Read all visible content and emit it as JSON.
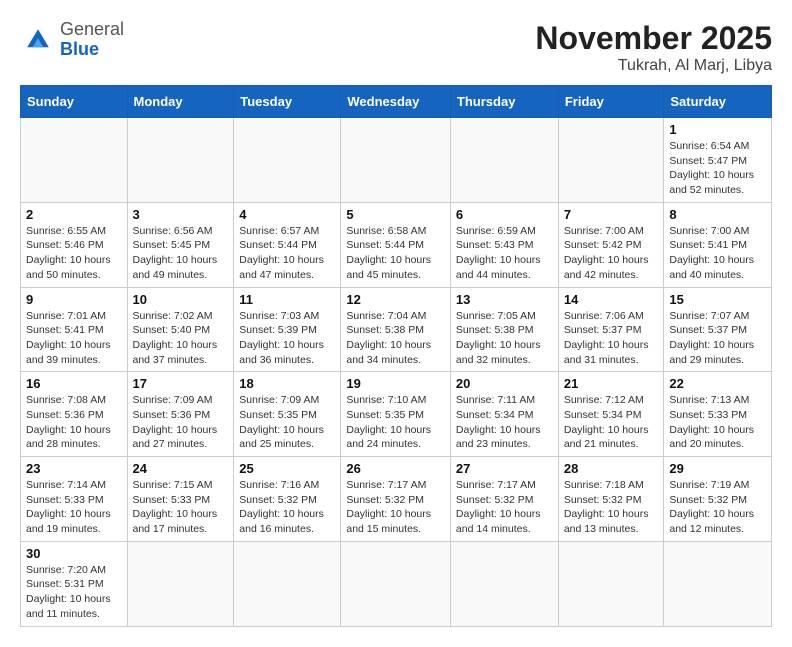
{
  "header": {
    "logo_general": "General",
    "logo_blue": "Blue",
    "month_title": "November 2025",
    "location": "Tukrah, Al Marj, Libya"
  },
  "weekdays": [
    "Sunday",
    "Monday",
    "Tuesday",
    "Wednesday",
    "Thursday",
    "Friday",
    "Saturday"
  ],
  "weeks": [
    [
      {
        "day": "",
        "info": ""
      },
      {
        "day": "",
        "info": ""
      },
      {
        "day": "",
        "info": ""
      },
      {
        "day": "",
        "info": ""
      },
      {
        "day": "",
        "info": ""
      },
      {
        "day": "",
        "info": ""
      },
      {
        "day": "1",
        "info": "Sunrise: 6:54 AM\nSunset: 5:47 PM\nDaylight: 10 hours and 52 minutes."
      }
    ],
    [
      {
        "day": "2",
        "info": "Sunrise: 6:55 AM\nSunset: 5:46 PM\nDaylight: 10 hours and 50 minutes."
      },
      {
        "day": "3",
        "info": "Sunrise: 6:56 AM\nSunset: 5:45 PM\nDaylight: 10 hours and 49 minutes."
      },
      {
        "day": "4",
        "info": "Sunrise: 6:57 AM\nSunset: 5:44 PM\nDaylight: 10 hours and 47 minutes."
      },
      {
        "day": "5",
        "info": "Sunrise: 6:58 AM\nSunset: 5:44 PM\nDaylight: 10 hours and 45 minutes."
      },
      {
        "day": "6",
        "info": "Sunrise: 6:59 AM\nSunset: 5:43 PM\nDaylight: 10 hours and 44 minutes."
      },
      {
        "day": "7",
        "info": "Sunrise: 7:00 AM\nSunset: 5:42 PM\nDaylight: 10 hours and 42 minutes."
      },
      {
        "day": "8",
        "info": "Sunrise: 7:00 AM\nSunset: 5:41 PM\nDaylight: 10 hours and 40 minutes."
      }
    ],
    [
      {
        "day": "9",
        "info": "Sunrise: 7:01 AM\nSunset: 5:41 PM\nDaylight: 10 hours and 39 minutes."
      },
      {
        "day": "10",
        "info": "Sunrise: 7:02 AM\nSunset: 5:40 PM\nDaylight: 10 hours and 37 minutes."
      },
      {
        "day": "11",
        "info": "Sunrise: 7:03 AM\nSunset: 5:39 PM\nDaylight: 10 hours and 36 minutes."
      },
      {
        "day": "12",
        "info": "Sunrise: 7:04 AM\nSunset: 5:38 PM\nDaylight: 10 hours and 34 minutes."
      },
      {
        "day": "13",
        "info": "Sunrise: 7:05 AM\nSunset: 5:38 PM\nDaylight: 10 hours and 32 minutes."
      },
      {
        "day": "14",
        "info": "Sunrise: 7:06 AM\nSunset: 5:37 PM\nDaylight: 10 hours and 31 minutes."
      },
      {
        "day": "15",
        "info": "Sunrise: 7:07 AM\nSunset: 5:37 PM\nDaylight: 10 hours and 29 minutes."
      }
    ],
    [
      {
        "day": "16",
        "info": "Sunrise: 7:08 AM\nSunset: 5:36 PM\nDaylight: 10 hours and 28 minutes."
      },
      {
        "day": "17",
        "info": "Sunrise: 7:09 AM\nSunset: 5:36 PM\nDaylight: 10 hours and 27 minutes."
      },
      {
        "day": "18",
        "info": "Sunrise: 7:09 AM\nSunset: 5:35 PM\nDaylight: 10 hours and 25 minutes."
      },
      {
        "day": "19",
        "info": "Sunrise: 7:10 AM\nSunset: 5:35 PM\nDaylight: 10 hours and 24 minutes."
      },
      {
        "day": "20",
        "info": "Sunrise: 7:11 AM\nSunset: 5:34 PM\nDaylight: 10 hours and 23 minutes."
      },
      {
        "day": "21",
        "info": "Sunrise: 7:12 AM\nSunset: 5:34 PM\nDaylight: 10 hours and 21 minutes."
      },
      {
        "day": "22",
        "info": "Sunrise: 7:13 AM\nSunset: 5:33 PM\nDaylight: 10 hours and 20 minutes."
      }
    ],
    [
      {
        "day": "23",
        "info": "Sunrise: 7:14 AM\nSunset: 5:33 PM\nDaylight: 10 hours and 19 minutes."
      },
      {
        "day": "24",
        "info": "Sunrise: 7:15 AM\nSunset: 5:33 PM\nDaylight: 10 hours and 17 minutes."
      },
      {
        "day": "25",
        "info": "Sunrise: 7:16 AM\nSunset: 5:32 PM\nDaylight: 10 hours and 16 minutes."
      },
      {
        "day": "26",
        "info": "Sunrise: 7:17 AM\nSunset: 5:32 PM\nDaylight: 10 hours and 15 minutes."
      },
      {
        "day": "27",
        "info": "Sunrise: 7:17 AM\nSunset: 5:32 PM\nDaylight: 10 hours and 14 minutes."
      },
      {
        "day": "28",
        "info": "Sunrise: 7:18 AM\nSunset: 5:32 PM\nDaylight: 10 hours and 13 minutes."
      },
      {
        "day": "29",
        "info": "Sunrise: 7:19 AM\nSunset: 5:32 PM\nDaylight: 10 hours and 12 minutes."
      }
    ],
    [
      {
        "day": "30",
        "info": "Sunrise: 7:20 AM\nSunset: 5:31 PM\nDaylight: 10 hours and 11 minutes."
      },
      {
        "day": "",
        "info": ""
      },
      {
        "day": "",
        "info": ""
      },
      {
        "day": "",
        "info": ""
      },
      {
        "day": "",
        "info": ""
      },
      {
        "day": "",
        "info": ""
      },
      {
        "day": "",
        "info": ""
      }
    ]
  ]
}
